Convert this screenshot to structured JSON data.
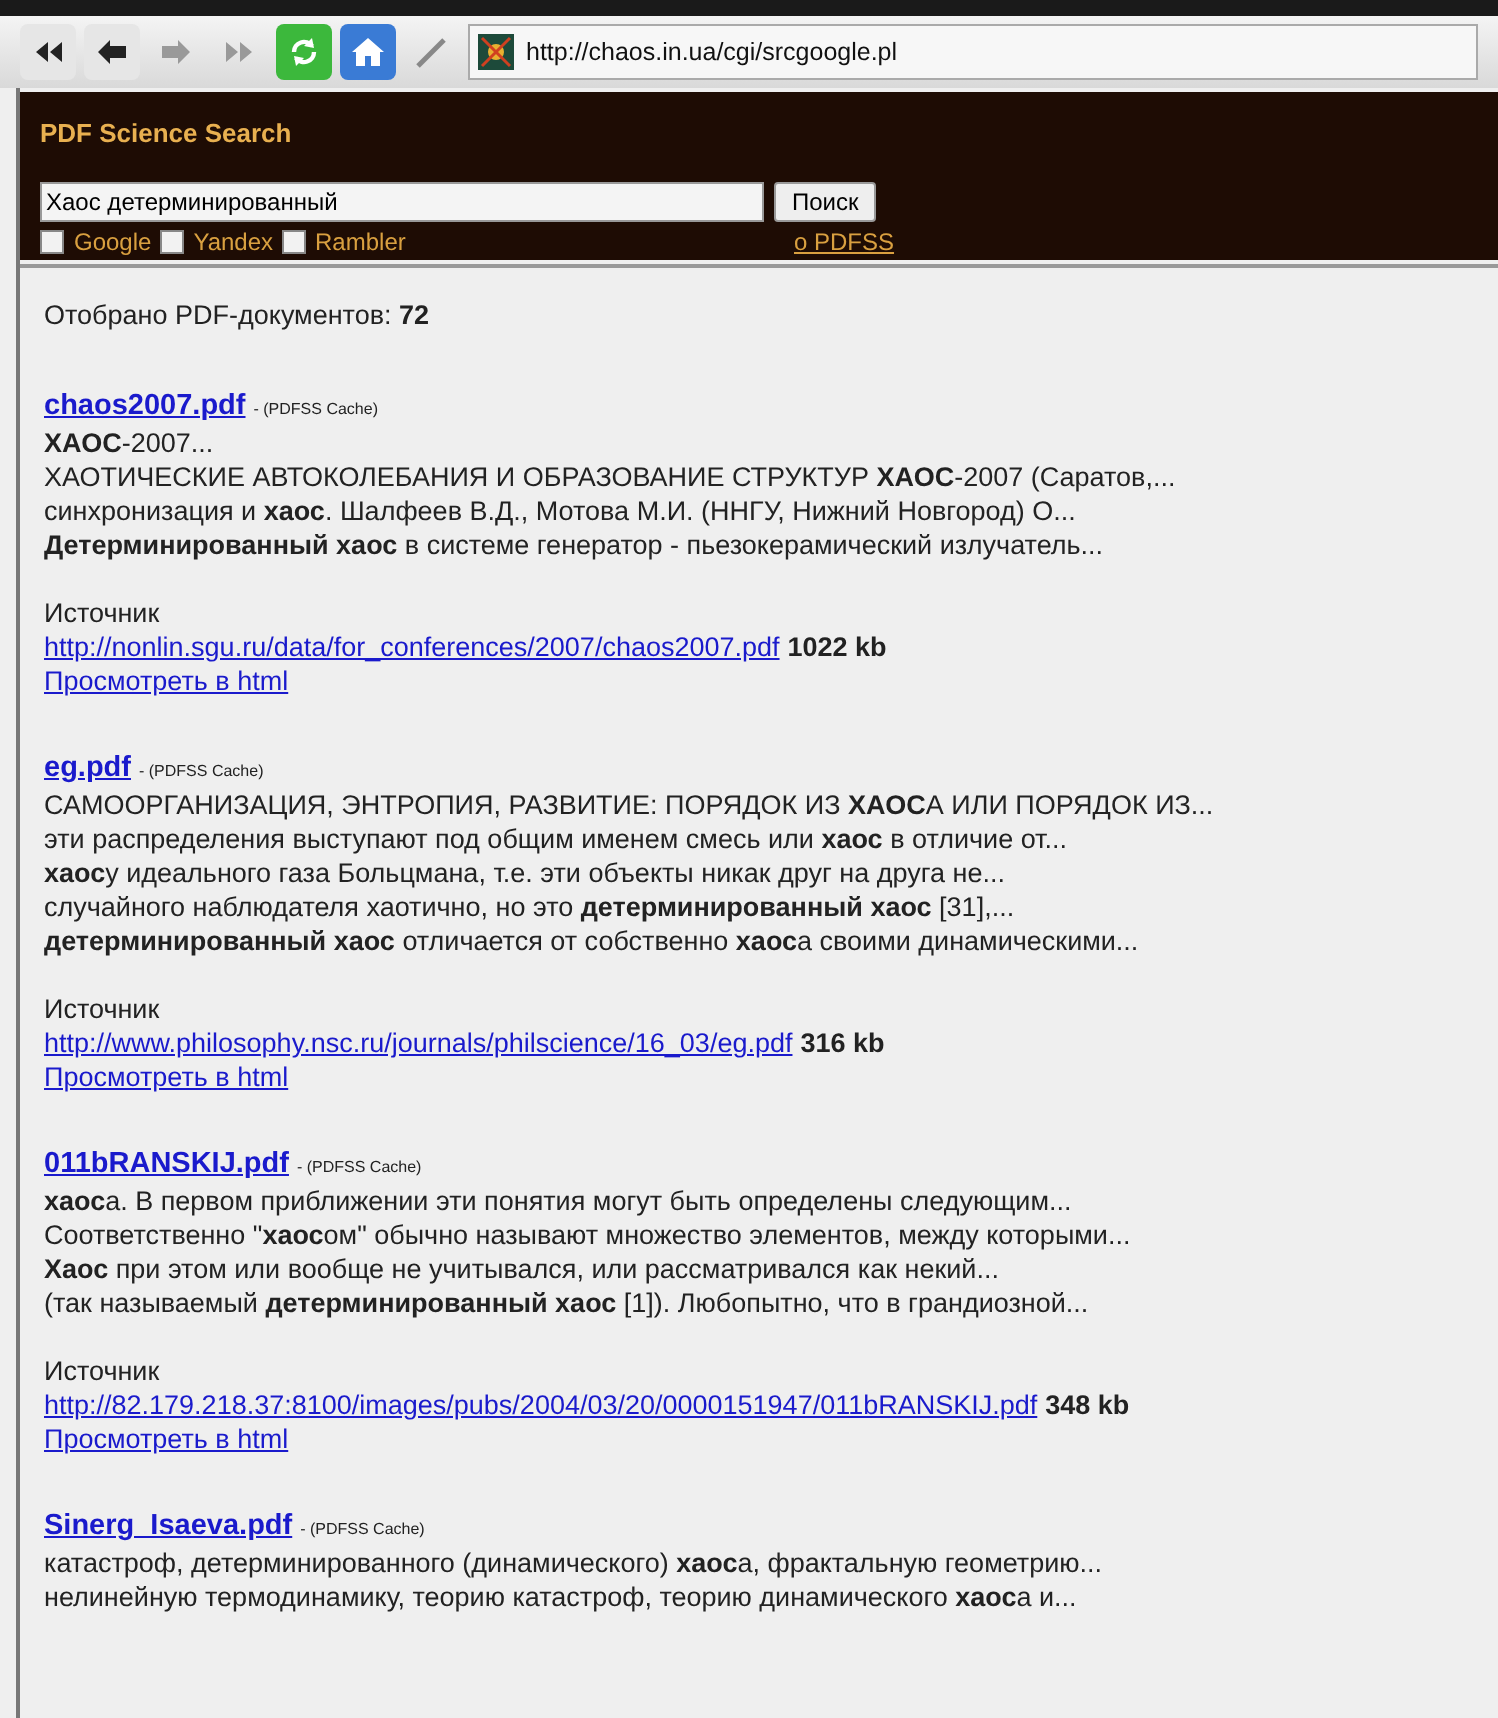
{
  "toolbar": {
    "address": "http://chaos.in.ua/cgi/srcgoogle.pl"
  },
  "header": {
    "title": "PDF Science Search",
    "search": {
      "value": "Хаос детерминированный",
      "button": "Поиск"
    },
    "engines": [
      {
        "label": "Google",
        "checked": false
      },
      {
        "label": "Yandex",
        "checked": false
      },
      {
        "label": "Rambler",
        "checked": false
      }
    ],
    "about_link": "о PDFSS"
  },
  "summary": {
    "label": "Отобрано PDF-документов:",
    "count": "72"
  },
  "results": [
    {
      "title": "chaos2007.pdf",
      "cache": "- (PDFSS Cache)",
      "snippet": [
        "**ХАОС**-2007...",
        "ХАОТИЧЕСКИЕ АВТОКОЛЕБАНИЯ И ОБРАЗОВАНИЕ СТРУКТУР **ХАОС**-2007 (Саратов,...",
        "синхронизация и **хаос**. Шалфеев В.Д., Мотова М.И. (ННГУ, Нижний Новгород) О...",
        "**Детерминированный хаос** в системе генератор - пьезокерамический излучатель..."
      ],
      "source_label": "Источник",
      "url": "http://nonlin.sgu.ru/data/for_conferences/2007/chaos2007.pdf",
      "size": "1022 kb",
      "html_link": "Просмотреть в html"
    },
    {
      "title": "eg.pdf",
      "cache": "- (PDFSS Cache)",
      "snippet": [
        "САМООРГАНИЗАЦИЯ, ЭНТРОПИЯ, РАЗВИТИЕ: ПОРЯДОК ИЗ **ХАОС**А ИЛИ ПОРЯДОК ИЗ...",
        "эти распределения выступают под общим именем смесь или **хаос** в отличие от...",
        "**хаос**у идеального газа Больцмана, т.е. эти объекты никак друг на друга не...",
        "случайного наблюдателя хаотично, но это **детерминированный хаос** [31],...",
        "**детерминированный хаос** отличается от собственно **хаос**а своими динамическими..."
      ],
      "source_label": "Источник",
      "url": "http://www.philosophy.nsc.ru/journals/philscience/16_03/eg.pdf",
      "size": "316 kb",
      "html_link": "Просмотреть в html"
    },
    {
      "title": "011bRANSKIJ.pdf",
      "cache": "- (PDFSS Cache)",
      "snippet": [
        "**хаос**а. В первом приближении эти понятия могут быть определены следующим...",
        "Соответственно \"**хаос**ом\" обычно называют множество элементов, между которыми...",
        "**Хаос** при этом или вообще не учитывался, или рассматривался как некий...",
        "(так называемый **детерминированный хаос** [1]). Любопытно, что в грандиозной..."
      ],
      "source_label": "Источник",
      "url": "http://82.179.218.37:8100/images/pubs/2004/03/20/0000151947/011bRANSKIJ.pdf",
      "size": "348 kb",
      "html_link": "Просмотреть в html"
    },
    {
      "title": "Sinerg_Isaeva.pdf",
      "cache": "- (PDFSS Cache)",
      "snippet": [
        "катастроф, детерминированного (динамического) **хаос**а, фрактальную геометрию...",
        "нелинейную термодинамику, теорию катастроф, теорию динамического **хаос**а и..."
      ]
    }
  ]
}
